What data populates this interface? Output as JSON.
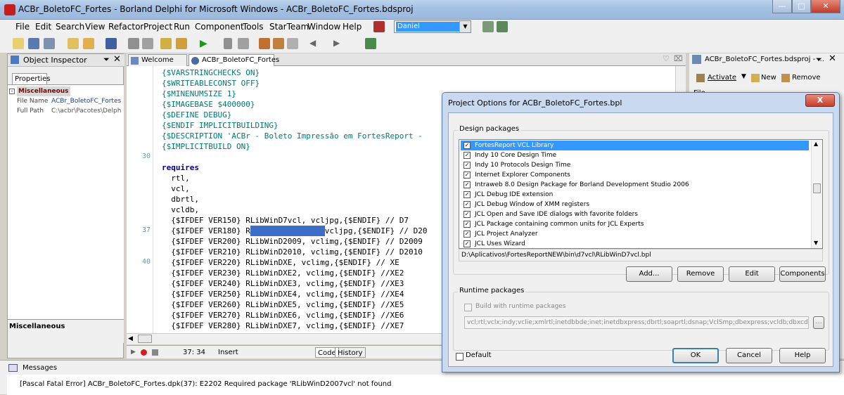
{
  "window": {
    "title": "ACBr_BoletoFC_Fortes - Borland Delphi for Microsoft Windows - ACBr_BoletoFC_Fortes.bdsproj"
  },
  "menu": [
    "File",
    "Edit",
    "Search",
    "View",
    "Refactor",
    "Project",
    "Run",
    "Component",
    "Tools",
    "StarTeam",
    "Window",
    "Help"
  ],
  "user_select": "Daniel",
  "object_inspector": {
    "title": "Object Inspector",
    "tab": "Properties",
    "category": "Miscellaneous",
    "rows": [
      {
        "key": "File Name",
        "value": "ACBr_BoletoFC_Fortes."
      },
      {
        "key": "Full Path",
        "value": "C:\\acbr\\Pacotes\\Delphi"
      }
    ],
    "description": "Miscellaneous"
  },
  "editor": {
    "tabs": [
      "Welcome Page",
      "ACBr_BoletoFC_Fortes"
    ],
    "line_numbers": {
      "l30": "30",
      "l37": "37",
      "l40": "40"
    },
    "lines": [
      "{$VARSTRINGCHECKS ON}",
      "{$WRITEABLECONST OFF}",
      "{$MINENUMSIZE 1}",
      "{$IMAGEBASE $400000}",
      "{$DEFINE DEBUG}",
      "{$ENDIF IMPLICITBUILDING}",
      "{$DESCRIPTION 'ACBr - Boleto Impressão em FortesReport -",
      "{$IMPLICITBUILD ON}",
      "",
      "requires",
      "  rtl,",
      "  vcl,",
      "  dbrtl,",
      "  vcldb,",
      "  {$IFDEF VER150} RLibWinD7vcl, vcljpg,{$ENDIF} // D7",
      "  {$IFDEF VER180} RLibWinD2007vcl, vcljpg,{$ENDIF} // D20",
      "  {$IFDEF VER200} RLibWinD2009, vclimg,{$ENDIF} // D2009",
      "  {$IFDEF VER210} RLibWinD2010, vclimg,{$ENDIF} // D2010",
      "  {$IFDEF VER220} RLibWinDXE, vclimg,{$ENDIF} // XE",
      "  {$IFDEF VER230} RLibWinDXE2, vclimg,{$ENDIF} //XE2",
      "  {$IFDEF VER240} RLibWinDXE3, vclimg,{$ENDIF} //XE3",
      "  {$IFDEF VER250} RLibWinDXE4, vclimg,{$ENDIF} //XE4",
      "  {$IFDEF VER260} RLibWinDXE5, vclimg,{$ENDIF} //XE5",
      "  {$IFDEF VER270} RLibWinDXE6, vclimg,{$ENDIF} //XE6",
      "  {$IFDEF VER280} RLibWinDXE7, vclimg,{$ENDIF} //XE7"
    ],
    "status": {
      "position": "37: 34",
      "mode": "Insert",
      "tab_code": "Code",
      "tab_history": "History"
    }
  },
  "project_manager": {
    "title": "ACBr_BoletoFC_Fortes.bdsproj - ...",
    "activate": "Activate",
    "new": "New",
    "remove": "Remove",
    "file_header": "File"
  },
  "dialog": {
    "title": "Project Options for ACBr_BoletoFC_Fortes.bpl",
    "close": "X",
    "design_packages_label": "Design packages",
    "packages": [
      "FortesReport VCL Library",
      "Indy 10 Core Design Time",
      "Indy 10 Protocols Design Time",
      "Internet Explorer Components",
      "Intraweb 8.0 Design Package for Borland Development Studio 2006",
      "JCL Debug IDE extension",
      "JCL Debug Window of XMM registers",
      "JCL Open and Save IDE dialogs with favorite folders",
      "JCL Package containing common units for JCL Experts",
      "JCL Project Analyzer",
      "JCL Uses Wizard"
    ],
    "package_path": "D:\\Aplicativos\\FortesReportNEW\\bin\\d7vcl\\RLibWinD7vcl.bpl",
    "buttons": {
      "add": "Add...",
      "remove": "Remove",
      "edit": "Edit",
      "components": "Components"
    },
    "runtime_label": "Runtime packages",
    "build_runtime": "Build with runtime packages",
    "runtime_list": "vcl;rtl;vclx;indy;vclie;xmlrtl;inetdbbde;inet;inetdbxpress;dbrtl;soaprtl;dsnap;VclSmp;dbexpress;vcldb;dbxcds;inetdb",
    "browse": "...",
    "default": "Default",
    "ok": "OK",
    "cancel": "Cancel",
    "help": "Help"
  },
  "messages": {
    "title": "Messages",
    "error": "[Pascal Fatal Error] ACBr_BoletoFC_Fortes.dpk(37): E2202 Required package 'RLibWinD2007vcl' not found"
  },
  "colors": {
    "selection": "#3399ff",
    "directive": "#007878",
    "keyword": "#000080"
  }
}
